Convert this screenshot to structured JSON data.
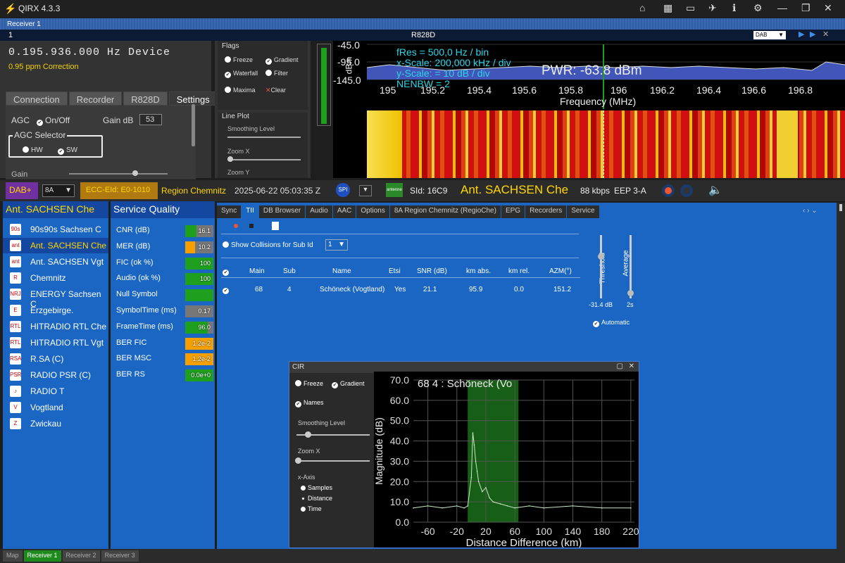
{
  "app": {
    "title": "QIRX 4.3.3",
    "accent": "#1a66c2"
  },
  "window_icons": [
    "home-icon",
    "panels-icon",
    "map-icon",
    "satellite-icon",
    "info-icon",
    "gear-icon",
    "minimize-icon",
    "restore-icon",
    "close-icon"
  ],
  "receiver": {
    "tab_label": "Receiver 1",
    "index": "1",
    "device": "R828D",
    "mode_select": "DAB"
  },
  "tuner": {
    "frequency": "0.195.936.000 Hz Device",
    "ppm": "0.95 ppm Correction"
  },
  "left_tabs": [
    "Connection",
    "Recorder",
    "R828D",
    "Settings"
  ],
  "settings": {
    "agc_label": "AGC",
    "agc_onoff": "On/Off",
    "gain_db_label": "Gain dB",
    "gain_db_value": "53",
    "agc_selector_label": "AGC Selector",
    "hw": "HW",
    "sw": "SW",
    "gain_label": "Gain"
  },
  "flags": {
    "title": "Flags",
    "freeze": "Freeze",
    "gradient": "Gradient",
    "waterfall": "Waterfall",
    "filter": "Filter",
    "maxima": "Maxima",
    "clear": "Clear",
    "line_plot": "Line Plot",
    "smoothing": "Smoothing Level",
    "zoom_x": "Zoom X",
    "zoom_y": "Zoom Y"
  },
  "spectrum": {
    "y_ticks": [
      "-45.0",
      "-95.0",
      "-145.0"
    ],
    "ylabel": "dBm",
    "x_ticks": [
      "195",
      "195.2",
      "195.4",
      "195.6",
      "195.8",
      "196",
      "196.2",
      "196.4",
      "196.6",
      "196.8"
    ],
    "xlabel": "Frequency (MHz)",
    "fres": "fRes = 500,0 Hz / bin",
    "xscale": "x-Scale: 200,000 kHz / div",
    "yscale": "y-Scale: = 10 dB / div",
    "nenbw": "NENBW = 2",
    "pwr": "PWR: -63.8 dBm"
  },
  "midbar": {
    "dab": "DAB+",
    "channel": "8A",
    "ecc": "ECC-EId: E0-1010",
    "region": "Region Chemnitz",
    "datetime": "2025-06-22  05:03:35 Z",
    "spi": "SPI",
    "sid": "SId: 16C9",
    "station": "Ant. SACHSEN Che",
    "bitrate": "88 kbps",
    "eep": "EEP 3-A"
  },
  "services": {
    "header": "Ant. SACHSEN Che",
    "items": [
      {
        "label": "90s90s Sachsen C",
        "icon": "90s"
      },
      {
        "label": "Ant. SACHSEN Che",
        "icon": "ant"
      },
      {
        "label": "Ant. SACHSEN Vgt",
        "icon": "ant"
      },
      {
        "label": "Chemnitz",
        "icon": "R"
      },
      {
        "label": "ENERGY Sachsen C",
        "icon": "NRJ"
      },
      {
        "label": "Erzgebirge.",
        "icon": "E"
      },
      {
        "label": "HITRADIO RTL Che",
        "icon": "RTL"
      },
      {
        "label": "HITRADIO RTL Vgt",
        "icon": "RTL"
      },
      {
        "label": "R.SA (C)",
        "icon": "RSA"
      },
      {
        "label": "RADIO PSR (C)",
        "icon": "PSR"
      },
      {
        "label": "RADIO T",
        "icon": "♪"
      },
      {
        "label": "Vogtland",
        "icon": "V"
      },
      {
        "label": "Zwickau",
        "icon": "Z"
      }
    ],
    "selected": 1
  },
  "quality": {
    "header": "Service Quality",
    "rows": [
      {
        "label": "CNR (dB)",
        "value": "16.1",
        "color": "#1ea01e",
        "level": 0.4
      },
      {
        "label": "MER (dB)",
        "value": "10.2",
        "color": "#f5a000",
        "level": 0.35
      },
      {
        "label": "FIC (ok %)",
        "value": "100",
        "color": "#1ea01e",
        "level": 1
      },
      {
        "label": "Audio (ok %)",
        "value": "100",
        "color": "#1ea01e",
        "level": 1
      },
      {
        "label": "Null Symbol",
        "value": "",
        "color": "#1ea01e",
        "level": 1
      },
      {
        "label": "SymbolTime (ms)",
        "value": "0.17",
        "color": "#777777",
        "level": 0
      },
      {
        "label": "FrameTime (ms)",
        "value": "96.0",
        "color": "#1ea01e",
        "level": 0.8
      },
      {
        "label": "BER FIC",
        "value": "1.2e-2",
        "color": "#f5a000",
        "level": 1
      },
      {
        "label": "BER MSC",
        "value": "1.2e-2",
        "color": "#f5a000",
        "level": 1
      },
      {
        "label": "BER RS",
        "value": "0.0e+0",
        "color": "#1ea01e",
        "level": 1
      }
    ]
  },
  "main_tabs": [
    "Sync",
    "TII",
    "DB Browser",
    "Audio",
    "AAC",
    "Options",
    "8A Region Chemnitz (RegioChe)",
    "EPG",
    "Recorders",
    "Service"
  ],
  "tii_panel": {
    "header_check": true,
    "show_collisions": "Show Collisions for Sub Id",
    "sub_id": "1",
    "threshold": "Threshold",
    "threshold_value": "-31.4 dB",
    "average": "Average",
    "average_value": "2s",
    "automatic": "Automatic",
    "zoom_x_level": false
  },
  "main_table": {
    "headers": [
      "Main",
      "Sub",
      "Name",
      "Etsi",
      "SNR (dB)",
      "km abs.",
      "km rel.",
      "AZM(°)"
    ],
    "rows": [
      [
        "68",
        "4",
        "Schöneck (Vogtland)",
        "Yes",
        "21.1",
        "95.9",
        "0.0",
        "151.2"
      ]
    ],
    "selected": 0
  },
  "cir_panel": {
    "title": "CIR",
    "freeze": "Freeze",
    "gradient": "Gradient",
    "names": "Names",
    "names_checked": true,
    "smoothing": "Smoothing Level",
    "zoom_x": "Zoom X",
    "x_axis": "x-Axis",
    "samples": "Samples",
    "distance": "Distance",
    "time": "Time"
  },
  "cir_chart": {
    "title": "68 4 : Schöneck (Vo",
    "ylabel": "Magnitude (dB)",
    "xlabel": "Distance Difference (km)"
  },
  "chart_data": {
    "type": "line",
    "title": "68 4 : Schöneck (Vo",
    "xlabel": "Distance Difference (km)",
    "ylabel": "Magnitude (dB)",
    "x_ticks": [
      "-60",
      "-20",
      "20",
      "60",
      "100",
      "140",
      "180",
      "220"
    ],
    "y_ticks": [
      "0.0",
      "10.0",
      "20.0",
      "30.0",
      "40.0",
      "50.0",
      "60.0",
      "70.0"
    ],
    "xlim": [
      -80,
      225
    ],
    "ylim": [
      0,
      70
    ],
    "highlight_band": [
      -5,
      65
    ],
    "series": [
      {
        "x": [
          -80,
          -60,
          -40,
          -20,
          -10,
          -5,
          0,
          2,
          4,
          6,
          8,
          10,
          15,
          20,
          25,
          30,
          40,
          50,
          60,
          80,
          100,
          140,
          180,
          220
        ],
        "y": [
          7,
          8,
          7,
          8,
          7,
          8,
          22,
          44,
          38,
          30,
          25,
          20,
          15,
          17,
          12,
          10,
          9,
          8,
          7,
          8,
          7,
          8,
          7,
          7
        ]
      }
    ]
  },
  "statusbar": [
    "Map",
    "Receiver 1",
    "Receiver 2",
    "Receiver 3"
  ]
}
